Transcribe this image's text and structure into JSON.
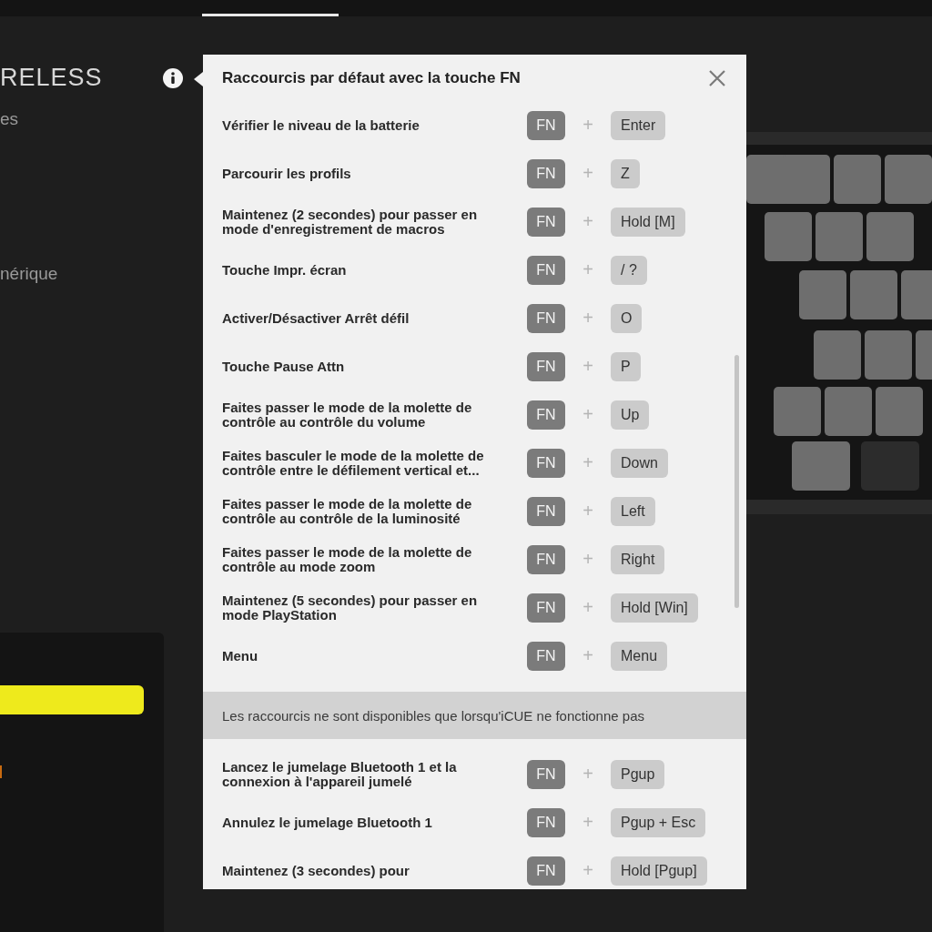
{
  "sidebar": {
    "title": "RELESS",
    "items": [
      "es",
      "nérique"
    ]
  },
  "popup": {
    "title": "Raccourcis par défaut avec la touche FN",
    "sections": [
      {
        "kind": "shortcuts",
        "rows": [
          {
            "description": "Vérifier le niveau de la batterie",
            "modifier": "FN",
            "plus": "+",
            "key": "Enter"
          },
          {
            "description": "Parcourir les profils",
            "modifier": "FN",
            "plus": "+",
            "key": "Z"
          },
          {
            "description": "Maintenez (2 secondes) pour passer en mode d'enregistrement de macros",
            "modifier": "FN",
            "plus": "+",
            "key": "Hold [M]"
          },
          {
            "description": "Touche Impr. écran",
            "modifier": "FN",
            "plus": "+",
            "key": "/ ?"
          },
          {
            "description": "Activer/Désactiver Arrêt défil",
            "modifier": "FN",
            "plus": "+",
            "key": "O"
          },
          {
            "description": "Touche Pause Attn",
            "modifier": "FN",
            "plus": "+",
            "key": "P"
          },
          {
            "description": "Faites passer le mode de la molette de contrôle au contrôle du volume",
            "modifier": "FN",
            "plus": "+",
            "key": "Up"
          },
          {
            "description": "Faites basculer le mode de la molette de contrôle entre le défilement vertical et...",
            "modifier": "FN",
            "plus": "+",
            "key": "Down"
          },
          {
            "description": "Faites passer le mode de la molette de contrôle au contrôle de la luminosité",
            "modifier": "FN",
            "plus": "+",
            "key": "Left"
          },
          {
            "description": "Faites passer le mode de la molette de contrôle au mode zoom",
            "modifier": "FN",
            "plus": "+",
            "key": "Right"
          },
          {
            "description": "Maintenez (5 secondes) pour passer en mode PlayStation",
            "modifier": "FN",
            "plus": "+",
            "key": "Hold [Win]"
          },
          {
            "description": "Menu",
            "modifier": "FN",
            "plus": "+",
            "key": "Menu"
          }
        ]
      },
      {
        "kind": "notice",
        "text": "Les raccourcis ne sont disponibles que lorsqu'iCUE ne fonctionne pas"
      },
      {
        "kind": "shortcuts",
        "rows": [
          {
            "description": "Lancez le jumelage Bluetooth 1 et la connexion à l'appareil jumelé",
            "modifier": "FN",
            "plus": "+",
            "key": "Pgup"
          },
          {
            "description": "Annulez le jumelage Bluetooth 1",
            "modifier": "FN",
            "plus": "+",
            "key": "Pgup + Esc"
          },
          {
            "description": "Maintenez (3 secondes) pour",
            "modifier": "FN",
            "plus": "+",
            "key": "Hold [Pgup]"
          }
        ]
      }
    ]
  }
}
